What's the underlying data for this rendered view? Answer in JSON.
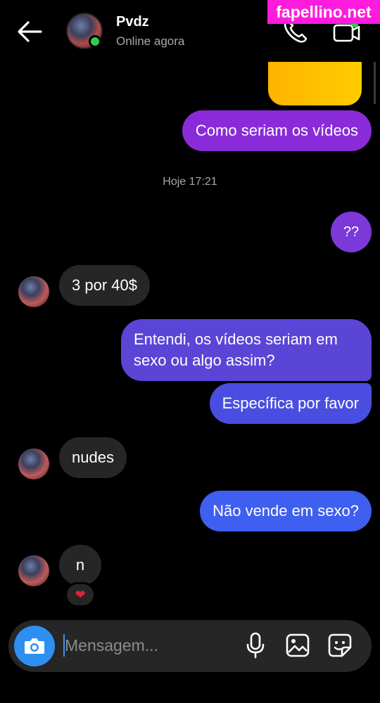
{
  "header": {
    "contact_name": "Pvdz",
    "status": "Online agora"
  },
  "watermark": "fapellino.net",
  "messages": [
    {
      "direction": "outgoing",
      "text": "Como seriam os vídeos"
    },
    {
      "direction": "outgoing",
      "text": "??"
    },
    {
      "direction": "incoming",
      "text": "3 por 40$"
    },
    {
      "direction": "outgoing",
      "text": "Entendi, os vídeos seriam em sexo ou algo assim?"
    },
    {
      "direction": "outgoing",
      "text": "Específica por favor"
    },
    {
      "direction": "incoming",
      "text": "nudes"
    },
    {
      "direction": "outgoing",
      "text": "Não vende em sexo?"
    },
    {
      "direction": "incoming",
      "text": "n",
      "reaction": "❤"
    }
  ],
  "timestamp": "Hoje 17:21",
  "composer": {
    "placeholder": "Mensagem..."
  },
  "icons": {
    "back": "arrow-left-icon",
    "call": "phone-icon",
    "video": "video-camera-icon",
    "camera": "camera-icon",
    "mic": "microphone-icon",
    "gallery": "image-icon",
    "sticker": "sticker-icon"
  },
  "colors": {
    "background": "#000000",
    "incoming_bubble": "#262626",
    "outgoing_gradient": [
      "#8a2bd9",
      "#5a45d6",
      "#3e5ff0"
    ],
    "online": "#2fcf4a",
    "camera_button": "#2f8ff0",
    "watermark": "#ff1bdc"
  }
}
